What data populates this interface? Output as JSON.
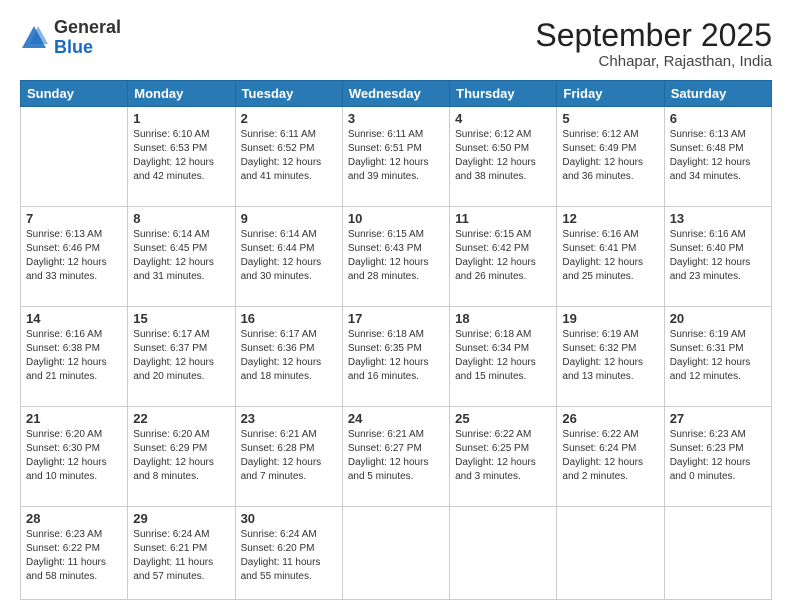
{
  "header": {
    "logo_general": "General",
    "logo_blue": "Blue",
    "month_title": "September 2025",
    "subtitle": "Chhapar, Rajasthan, India"
  },
  "days": [
    "Sunday",
    "Monday",
    "Tuesday",
    "Wednesday",
    "Thursday",
    "Friday",
    "Saturday"
  ],
  "weeks": [
    [
      {
        "num": "",
        "content": ""
      },
      {
        "num": "1",
        "content": "Sunrise: 6:10 AM\nSunset: 6:53 PM\nDaylight: 12 hours\nand 42 minutes."
      },
      {
        "num": "2",
        "content": "Sunrise: 6:11 AM\nSunset: 6:52 PM\nDaylight: 12 hours\nand 41 minutes."
      },
      {
        "num": "3",
        "content": "Sunrise: 6:11 AM\nSunset: 6:51 PM\nDaylight: 12 hours\nand 39 minutes."
      },
      {
        "num": "4",
        "content": "Sunrise: 6:12 AM\nSunset: 6:50 PM\nDaylight: 12 hours\nand 38 minutes."
      },
      {
        "num": "5",
        "content": "Sunrise: 6:12 AM\nSunset: 6:49 PM\nDaylight: 12 hours\nand 36 minutes."
      },
      {
        "num": "6",
        "content": "Sunrise: 6:13 AM\nSunset: 6:48 PM\nDaylight: 12 hours\nand 34 minutes."
      }
    ],
    [
      {
        "num": "7",
        "content": "Sunrise: 6:13 AM\nSunset: 6:46 PM\nDaylight: 12 hours\nand 33 minutes."
      },
      {
        "num": "8",
        "content": "Sunrise: 6:14 AM\nSunset: 6:45 PM\nDaylight: 12 hours\nand 31 minutes."
      },
      {
        "num": "9",
        "content": "Sunrise: 6:14 AM\nSunset: 6:44 PM\nDaylight: 12 hours\nand 30 minutes."
      },
      {
        "num": "10",
        "content": "Sunrise: 6:15 AM\nSunset: 6:43 PM\nDaylight: 12 hours\nand 28 minutes."
      },
      {
        "num": "11",
        "content": "Sunrise: 6:15 AM\nSunset: 6:42 PM\nDaylight: 12 hours\nand 26 minutes."
      },
      {
        "num": "12",
        "content": "Sunrise: 6:16 AM\nSunset: 6:41 PM\nDaylight: 12 hours\nand 25 minutes."
      },
      {
        "num": "13",
        "content": "Sunrise: 6:16 AM\nSunset: 6:40 PM\nDaylight: 12 hours\nand 23 minutes."
      }
    ],
    [
      {
        "num": "14",
        "content": "Sunrise: 6:16 AM\nSunset: 6:38 PM\nDaylight: 12 hours\nand 21 minutes."
      },
      {
        "num": "15",
        "content": "Sunrise: 6:17 AM\nSunset: 6:37 PM\nDaylight: 12 hours\nand 20 minutes."
      },
      {
        "num": "16",
        "content": "Sunrise: 6:17 AM\nSunset: 6:36 PM\nDaylight: 12 hours\nand 18 minutes."
      },
      {
        "num": "17",
        "content": "Sunrise: 6:18 AM\nSunset: 6:35 PM\nDaylight: 12 hours\nand 16 minutes."
      },
      {
        "num": "18",
        "content": "Sunrise: 6:18 AM\nSunset: 6:34 PM\nDaylight: 12 hours\nand 15 minutes."
      },
      {
        "num": "19",
        "content": "Sunrise: 6:19 AM\nSunset: 6:32 PM\nDaylight: 12 hours\nand 13 minutes."
      },
      {
        "num": "20",
        "content": "Sunrise: 6:19 AM\nSunset: 6:31 PM\nDaylight: 12 hours\nand 12 minutes."
      }
    ],
    [
      {
        "num": "21",
        "content": "Sunrise: 6:20 AM\nSunset: 6:30 PM\nDaylight: 12 hours\nand 10 minutes."
      },
      {
        "num": "22",
        "content": "Sunrise: 6:20 AM\nSunset: 6:29 PM\nDaylight: 12 hours\nand 8 minutes."
      },
      {
        "num": "23",
        "content": "Sunrise: 6:21 AM\nSunset: 6:28 PM\nDaylight: 12 hours\nand 7 minutes."
      },
      {
        "num": "24",
        "content": "Sunrise: 6:21 AM\nSunset: 6:27 PM\nDaylight: 12 hours\nand 5 minutes."
      },
      {
        "num": "25",
        "content": "Sunrise: 6:22 AM\nSunset: 6:25 PM\nDaylight: 12 hours\nand 3 minutes."
      },
      {
        "num": "26",
        "content": "Sunrise: 6:22 AM\nSunset: 6:24 PM\nDaylight: 12 hours\nand 2 minutes."
      },
      {
        "num": "27",
        "content": "Sunrise: 6:23 AM\nSunset: 6:23 PM\nDaylight: 12 hours\nand 0 minutes."
      }
    ],
    [
      {
        "num": "28",
        "content": "Sunrise: 6:23 AM\nSunset: 6:22 PM\nDaylight: 11 hours\nand 58 minutes."
      },
      {
        "num": "29",
        "content": "Sunrise: 6:24 AM\nSunset: 6:21 PM\nDaylight: 11 hours\nand 57 minutes."
      },
      {
        "num": "30",
        "content": "Sunrise: 6:24 AM\nSunset: 6:20 PM\nDaylight: 11 hours\nand 55 minutes."
      },
      {
        "num": "",
        "content": ""
      },
      {
        "num": "",
        "content": ""
      },
      {
        "num": "",
        "content": ""
      },
      {
        "num": "",
        "content": ""
      }
    ]
  ]
}
